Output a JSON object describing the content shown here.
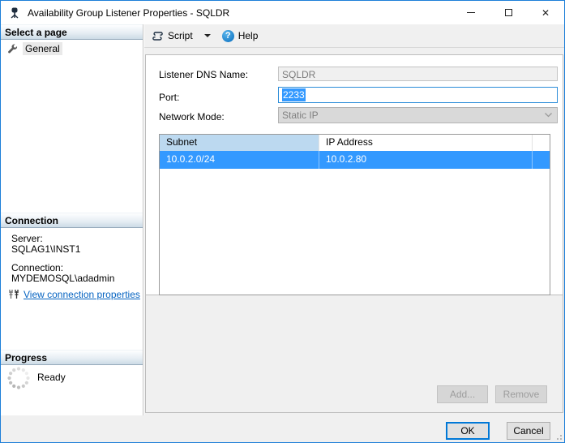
{
  "window": {
    "title": "Availability Group Listener Properties - SQLDR"
  },
  "icons": {
    "close_glyph": "✕",
    "help_glyph": "?"
  },
  "sidebar": {
    "select_a_page": {
      "header": "Select a page",
      "items": [
        {
          "label": "General"
        }
      ]
    },
    "connection": {
      "header": "Connection",
      "server_label": "Server:",
      "server_value": "SQLAG1\\INST1",
      "connection_label": "Connection:",
      "connection_value": "MYDEMOSQL\\adadmin",
      "link_label": "View connection properties"
    },
    "progress": {
      "header": "Progress",
      "status": "Ready"
    }
  },
  "toolbar": {
    "script_label": "Script",
    "help_label": "Help"
  },
  "form": {
    "dns": {
      "label": "Listener DNS Name:",
      "value": "SQLDR"
    },
    "port": {
      "label": "Port:",
      "value": "2233"
    },
    "network_mode": {
      "label": "Network Mode:",
      "value": "Static IP"
    }
  },
  "table": {
    "columns": [
      "Subnet",
      "IP Address"
    ],
    "rows": [
      {
        "subnet": "10.0.2.0/24",
        "ip": "10.0.2.80"
      }
    ]
  },
  "buttons": {
    "add": "Add...",
    "remove": "Remove",
    "ok": "OK",
    "cancel": "Cancel"
  },
  "colors": {
    "window_border": "#1d7fd8",
    "selection_blue": "#3399ff",
    "sorted_column_header": "#bcd9f0",
    "link": "#0563c1",
    "ok_focus_border": "#0078d7",
    "disabled_field_bg": "#d9d9d9"
  }
}
